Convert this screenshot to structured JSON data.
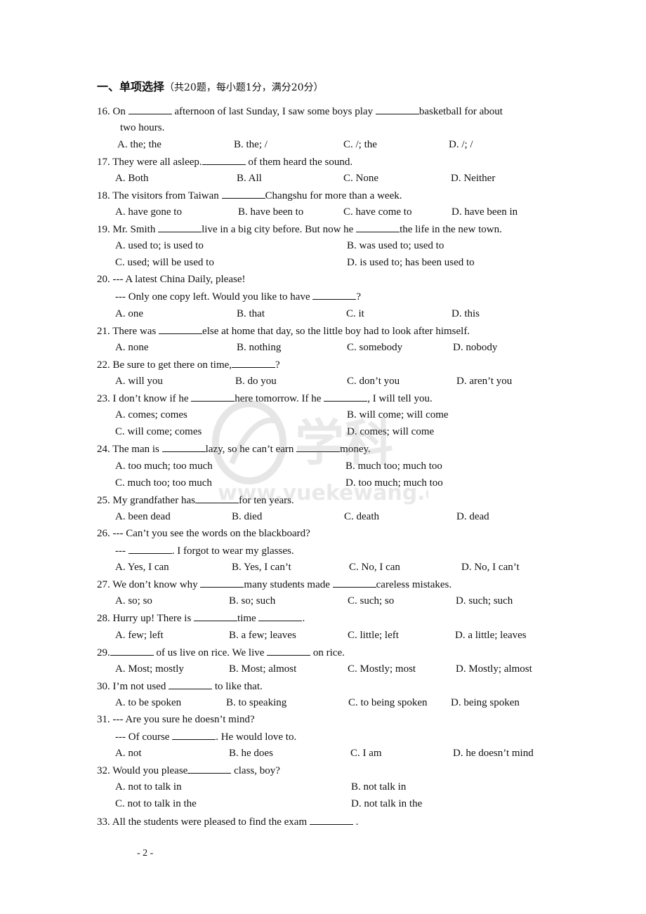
{
  "section": {
    "prefix": "一、单项选择",
    "note": "（共20题，每小题1分，满分20分）"
  },
  "questions": [
    {
      "num": "16.",
      "lines": [
        "On ______ afternoon of last Sunday, I saw some boys play ______basketball for about",
        "two hours."
      ],
      "options": [
        "A. the; the",
        "B. the; /",
        "C. /; the",
        "D. /; /"
      ]
    },
    {
      "num": "17.",
      "lines": [
        "They were all asleep.______ of them heard the sound."
      ],
      "options": [
        "A. Both",
        "B. All",
        "C. None",
        "D. Neither"
      ]
    },
    {
      "num": "18.",
      "lines": [
        "The visitors from Taiwan ______Changshu for more than a week."
      ],
      "options": [
        "A. have gone to",
        "B. have been to",
        "C. have come to",
        "D. have been in"
      ]
    },
    {
      "num": "19.",
      "lines": [
        "Mr. Smith ______live in a big city before. But now he ______the life in the new town."
      ],
      "options": [
        "A. used to; is used to",
        "B. was used to; used to",
        "C. used; will be used to",
        "D. is used to; has been used to"
      ]
    },
    {
      "num": "20.",
      "lines": [
        "--- A latest China Daily, please!",
        "--- Only one copy left. Would you like to have ______?"
      ],
      "options": [
        "A. one",
        "B. that",
        "C. it",
        "D. this"
      ]
    },
    {
      "num": "21.",
      "lines": [
        "There was ______else at home that day, so the little boy had to look after himself."
      ],
      "options": [
        "A. none",
        "B. nothing",
        "C. somebody",
        "D. nobody"
      ]
    },
    {
      "num": "22.",
      "lines": [
        "Be sure to get there on time,______?"
      ],
      "options": [
        "A. will you",
        "B. do you",
        "C. don’t you",
        "D. aren’t you"
      ]
    },
    {
      "num": "23.",
      "lines": [
        "I don’t know if he ______here tomorrow. If he ______, I will tell you."
      ],
      "options": [
        "A. comes; comes",
        "B. will come; will come",
        "C. will come; comes",
        "D. comes; will come"
      ]
    },
    {
      "num": "24.",
      "lines": [
        "The man is ______lazy, so he can’t earn ______money."
      ],
      "options": [
        "A. too much; too much",
        "B. much too; much too",
        "C. much too; too much",
        "D. too much; much too"
      ]
    },
    {
      "num": "25.",
      "lines": [
        "My grandfather has______for ten years."
      ],
      "options": [
        "A. been dead",
        "B. died",
        "C. death",
        "D. dead"
      ]
    },
    {
      "num": "26.",
      "lines": [
        "--- Can’t you see the words on the blackboard?",
        "--- ______. I forgot to wear my glasses."
      ],
      "options": [
        "A. Yes, I can",
        "B. Yes, I can’t",
        "C. No, I can",
        "D. No, I can’t"
      ]
    },
    {
      "num": "27.",
      "lines": [
        "We don’t know why ______many students made ______careless mistakes."
      ],
      "options": [
        "A. so; so",
        "B. so; such",
        "C. such; so",
        "D. such; such"
      ]
    },
    {
      "num": "28.",
      "lines": [
        "Hurry up! There is ______time ______."
      ],
      "options": [
        "A. few; left",
        "B. a few; leaves",
        "C. little; left",
        "D. a little; leaves"
      ]
    },
    {
      "num": "29.",
      "lines": [
        "______ of us live on rice. We live ______ on rice."
      ],
      "options": [
        "A. Most; mostly",
        "B. Most; almost",
        "C. Mostly; most",
        "D. Mostly; almost"
      ]
    },
    {
      "num": "30.",
      "lines": [
        "I’m not used ______ to like that."
      ],
      "options": [
        "A. to be spoken",
        "B. to speaking",
        "C. to being spoken",
        "D. being spoken"
      ]
    },
    {
      "num": "31.",
      "lines": [
        "--- Are you sure he doesn’t mind?",
        "--- Of course ______. He would love to."
      ],
      "options": [
        "A. not",
        "B. he does",
        "C. I am",
        "D. he doesn’t mind"
      ]
    },
    {
      "num": "32.",
      "lines": [
        "Would you please______ class, boy?"
      ],
      "options": [
        "A. not to talk in",
        "B. not talk in",
        "C. not to talk in the",
        "D. not talk in the"
      ]
    },
    {
      "num": "33.",
      "lines": [
        "All the students were pleased to find the exam ______ ."
      ],
      "options": []
    }
  ],
  "page_number": "- 2 -",
  "watermark": "www.yuekewang.com"
}
